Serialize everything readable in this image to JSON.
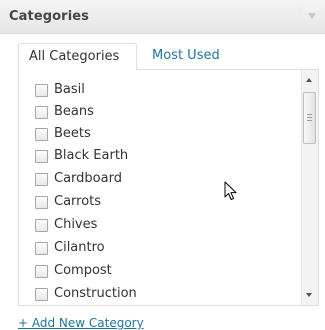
{
  "panel": {
    "title": "Categories"
  },
  "tabs": [
    {
      "label": "All Categories",
      "active": true
    },
    {
      "label": "Most Used",
      "active": false
    }
  ],
  "categories": [
    {
      "label": "Basil",
      "checked": false
    },
    {
      "label": "Beans",
      "checked": false
    },
    {
      "label": "Beets",
      "checked": false
    },
    {
      "label": "Black Earth",
      "checked": false
    },
    {
      "label": "Cardboard",
      "checked": false
    },
    {
      "label": "Carrots",
      "checked": false
    },
    {
      "label": "Chives",
      "checked": false
    },
    {
      "label": "Cilantro",
      "checked": false
    },
    {
      "label": "Compost",
      "checked": false
    },
    {
      "label": "Construction",
      "checked": false
    }
  ],
  "add_link": {
    "label": "+ Add New Category"
  },
  "icons": {
    "toggle": "collapse-arrow-icon",
    "cursor": "mouse-pointer-icon",
    "scroll_up": "scroll-up-arrow-icon",
    "scroll_down": "scroll-down-arrow-icon"
  },
  "colors": {
    "link": "#21759b",
    "text": "#333333",
    "header_text": "#464646",
    "border": "#dfdfdf"
  }
}
